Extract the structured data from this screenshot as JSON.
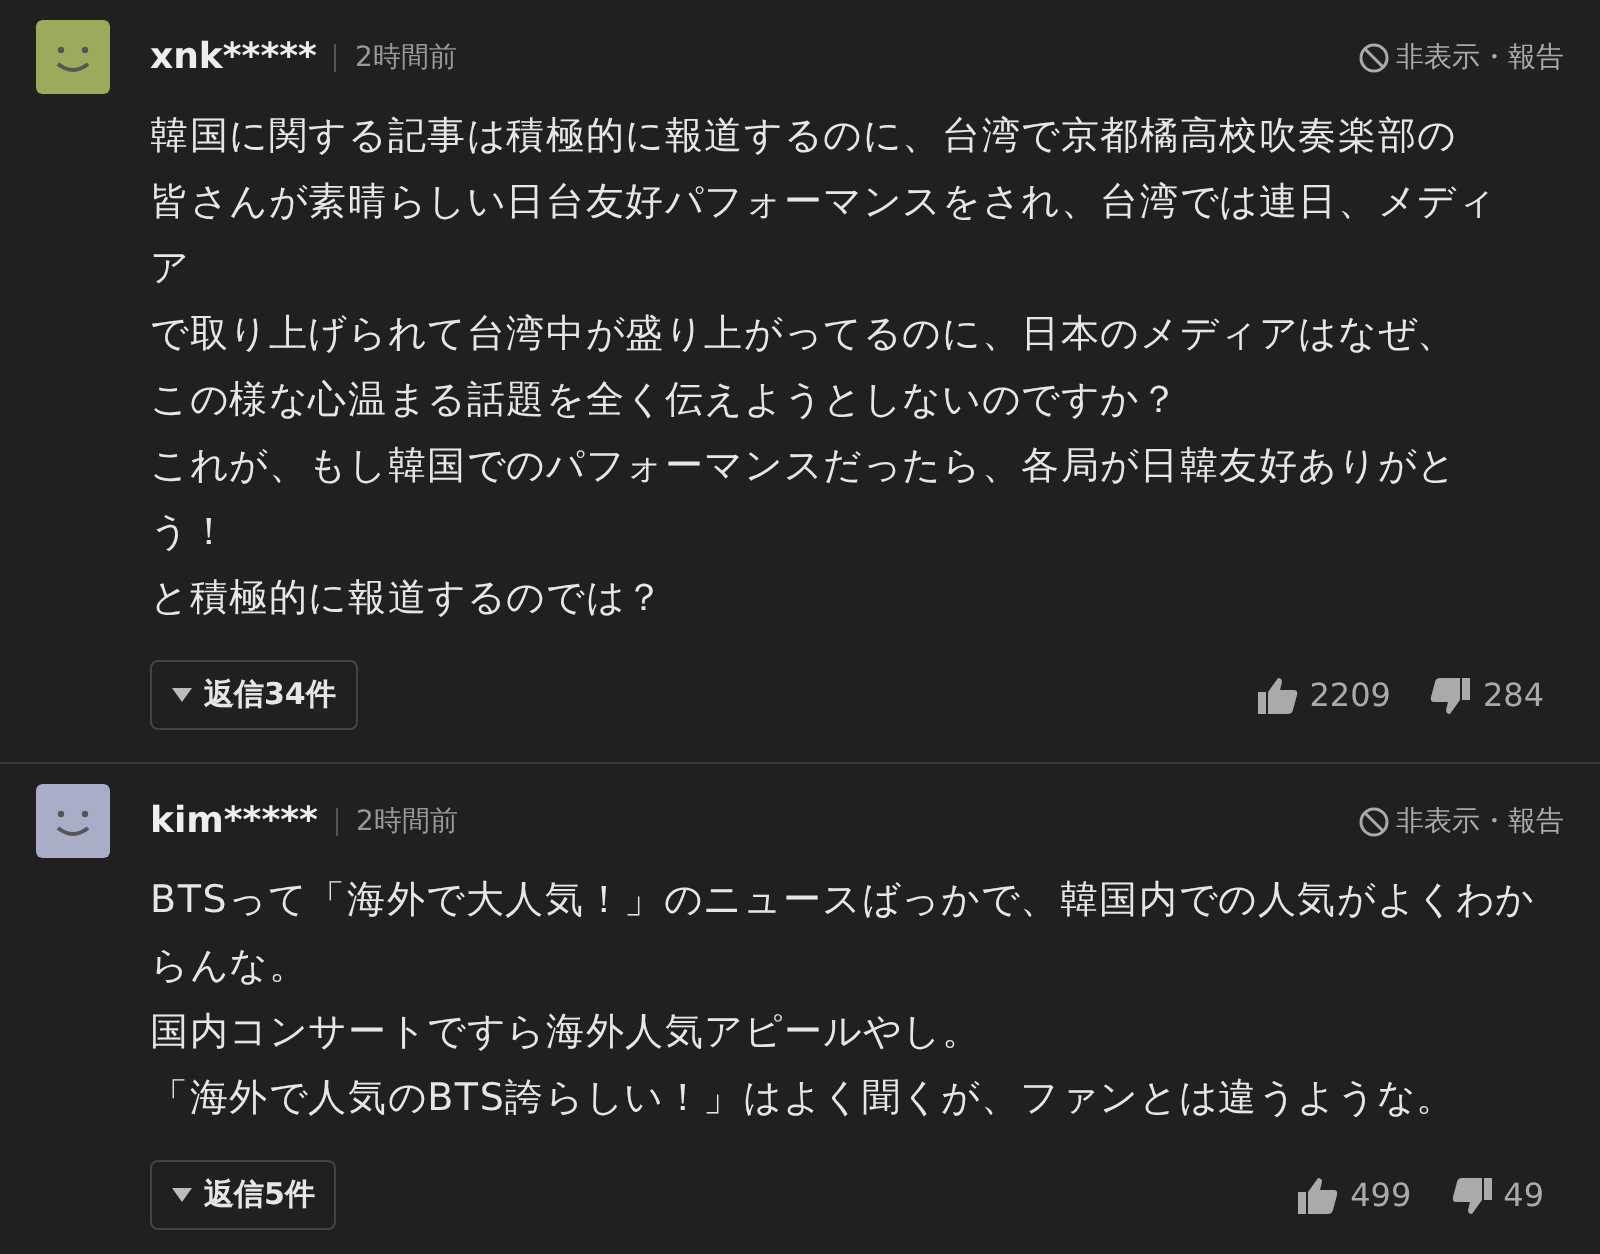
{
  "comments": [
    {
      "color": "#9aab5c",
      "user": "xnk*****",
      "time": "2時間前",
      "hide_report": "非表示・報告",
      "body": [
        "韓国に関する記事は積極的に報道するのに、台湾で京都橘高校吹奏楽部の",
        "皆さんが素晴らしい日台友好パフォーマンスをされ、台湾では連日、メディ",
        "ア",
        "で取り上げられて台湾中が盛り上がってるのに、日本のメディアはなぜ、",
        "この様な心温まる話題を全く伝えようとしないのですか？",
        "これが、もし韓国でのパフォーマンスだったら、各局が日韓友好ありがと",
        "う！",
        "と積極的に報道するのでは？"
      ],
      "replies": "返信34件",
      "likes": "2209",
      "dislikes": "284"
    },
    {
      "color": "#a9adc8",
      "user": "kim*****",
      "time": "2時間前",
      "hide_report": "非表示・報告",
      "body": [
        "BTSって「海外で大人気！」のニュースばっかで、韓国内での人気がよくわか",
        "らんな。",
        "国内コンサートですら海外人気アピールやし。",
        "「海外で人気のBTS誇らしい！」はよく聞くが、ファンとは違うような。"
      ],
      "replies": "返信5件",
      "likes": "499",
      "dislikes": "49"
    }
  ]
}
